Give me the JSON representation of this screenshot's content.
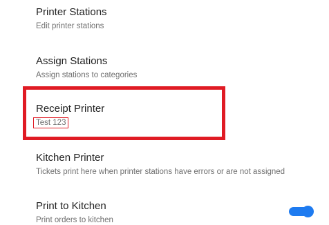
{
  "settings": {
    "printer_stations": {
      "title": "Printer Stations",
      "subtitle": "Edit printer stations"
    },
    "assign_stations": {
      "title": "Assign Stations",
      "subtitle": "Assign stations to categories"
    },
    "receipt_printer": {
      "title": "Receipt Printer",
      "value": "Test 123"
    },
    "kitchen_printer": {
      "title": "Kitchen Printer",
      "subtitle": "Tickets print here when printer stations have errors or are not assigned"
    },
    "print_to_kitchen": {
      "title": "Print to Kitchen",
      "subtitle": "Print orders to kitchen",
      "enabled": true
    }
  },
  "colors": {
    "highlight": "#e01b24",
    "toggle_on": "#1e7bf0"
  }
}
